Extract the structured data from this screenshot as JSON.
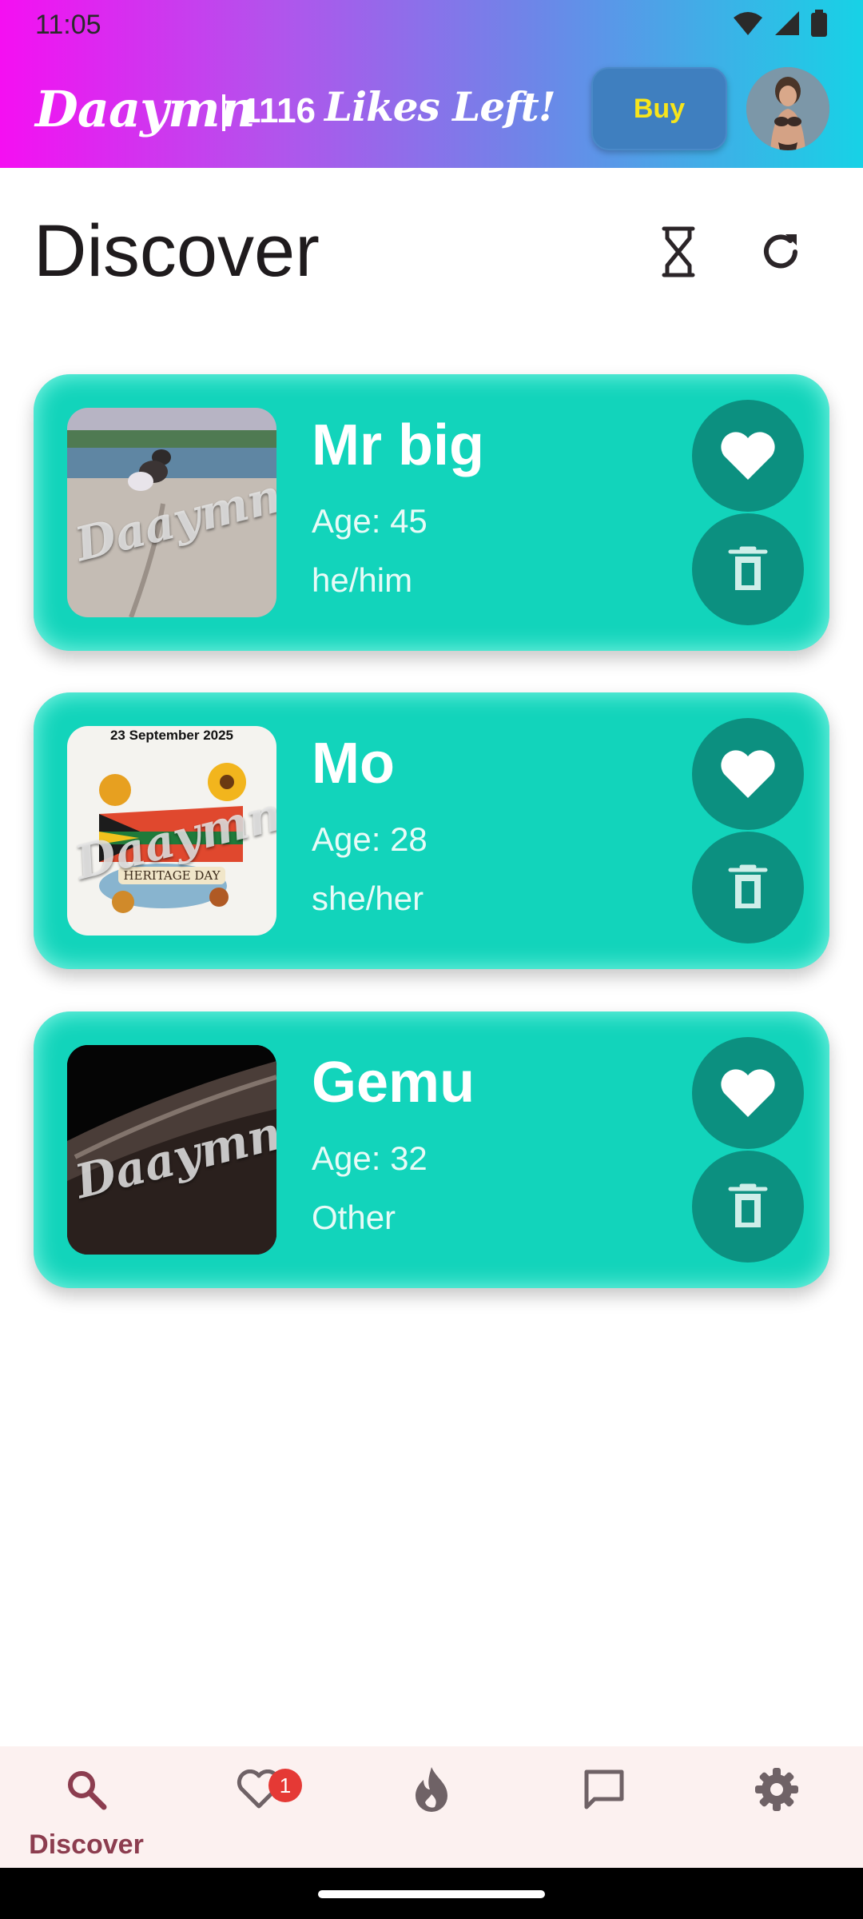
{
  "status_bar": {
    "time": "11:05",
    "icons": [
      "wifi-icon",
      "signal-icon",
      "battery-icon"
    ]
  },
  "header": {
    "brand": "Daaymn",
    "likes_count": "1116",
    "likes_text": "Likes Left!",
    "buy_label": "Buy",
    "gradient": [
      "#f50ff2",
      "#17d2e6"
    ]
  },
  "main": {
    "title": "Discover",
    "actions": [
      "hourglass-icon",
      "refresh-icon"
    ]
  },
  "profiles": [
    {
      "name": "Mr big",
      "age": "Age: 45",
      "pronouns": "he/him",
      "photo_watermark": "Daaymn!"
    },
    {
      "name": "Mo",
      "age": "Age: 28",
      "pronouns": "she/her",
      "photo_caption": "23 September 2025",
      "photo_banner": "HERITAGE DAY",
      "photo_watermark": "Daaymn!"
    },
    {
      "name": "Gemu",
      "age": "Age: 32",
      "pronouns": "Other",
      "photo_watermark": "Daaymn!"
    }
  ],
  "card_colors": {
    "background": "#12d4bb",
    "button": "#0c9080"
  },
  "bottom_nav": {
    "items": [
      {
        "icon": "search-icon",
        "label": "Discover",
        "active": true
      },
      {
        "icon": "heart-outline-icon",
        "badge": "1"
      },
      {
        "icon": "flame-icon"
      },
      {
        "icon": "chat-icon"
      },
      {
        "icon": "gear-icon"
      }
    ],
    "active_color": "#8c3d4f"
  }
}
